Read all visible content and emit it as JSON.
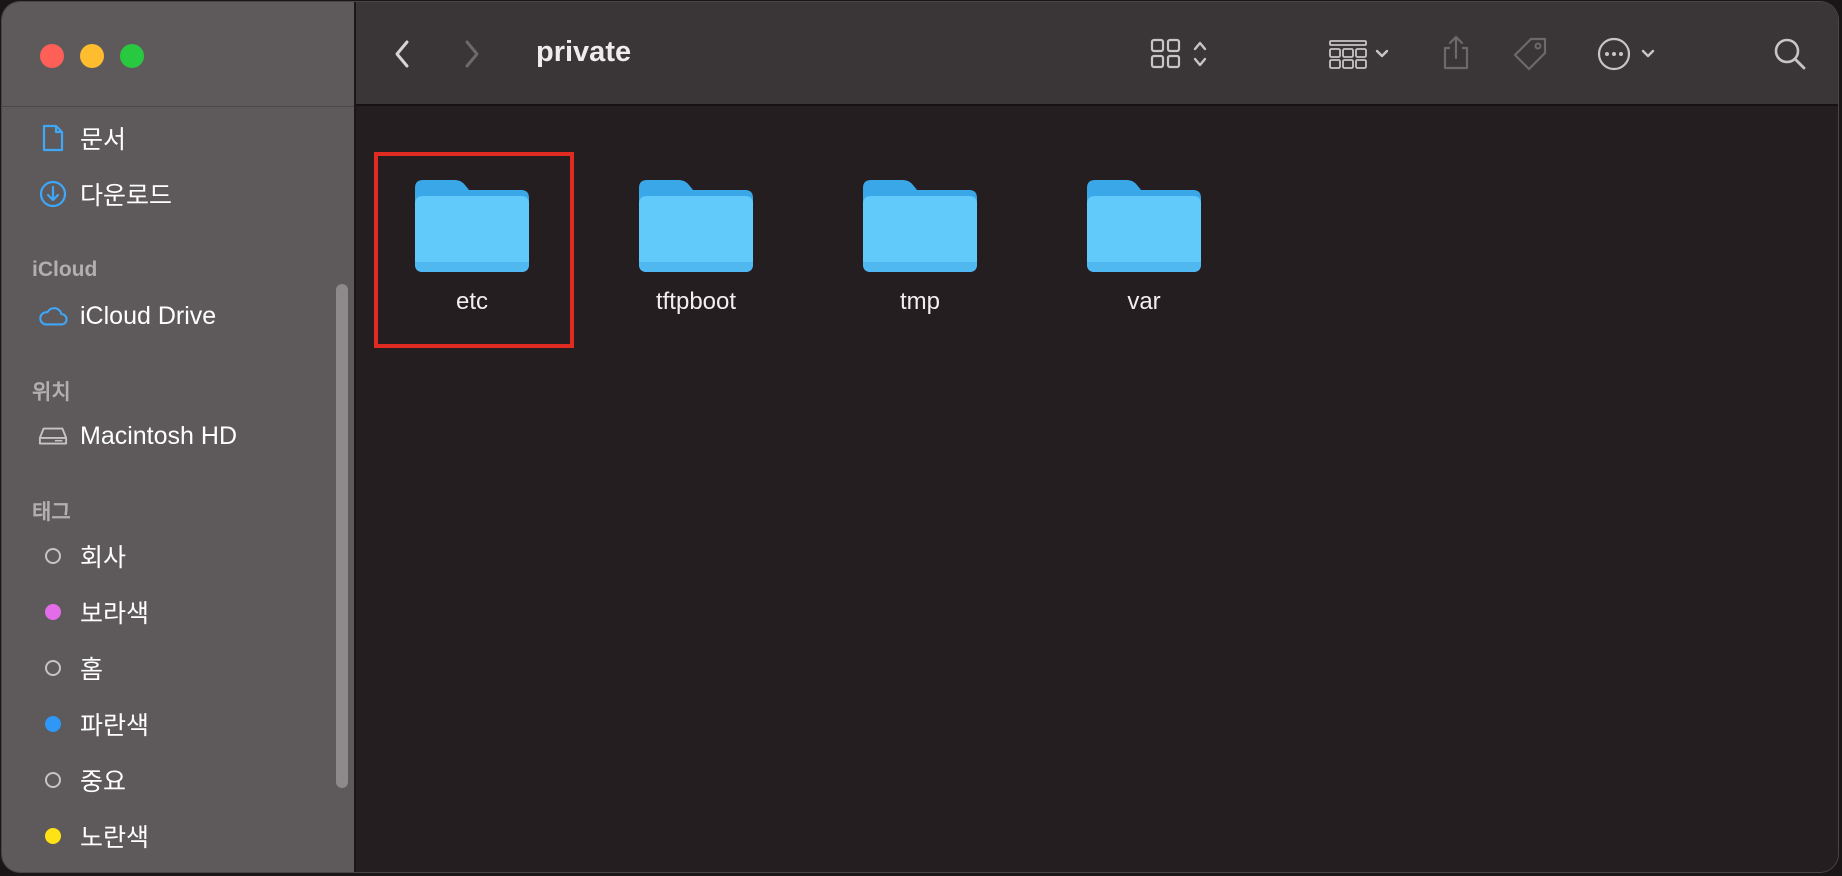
{
  "window": {
    "title": "private"
  },
  "sidebar": {
    "favorites": [
      {
        "label": "문서",
        "icon": "document-icon"
      },
      {
        "label": "다운로드",
        "icon": "download-icon"
      }
    ],
    "sections": {
      "icloud_heading": "iCloud",
      "icloud_items": [
        {
          "label": "iCloud Drive",
          "icon": "cloud-icon"
        }
      ],
      "locations_heading": "위치",
      "locations_items": [
        {
          "label": "Macintosh HD",
          "icon": "hard-drive-icon"
        }
      ],
      "tags_heading": "태그",
      "tags": [
        {
          "label": "회사",
          "color": ""
        },
        {
          "label": "보라색",
          "color": "#e36ce8"
        },
        {
          "label": "홈",
          "color": ""
        },
        {
          "label": "파란색",
          "color": "#2f97f5"
        },
        {
          "label": "중요",
          "color": ""
        },
        {
          "label": "노란색",
          "color": "#ffe216"
        }
      ]
    }
  },
  "toolbar": {
    "back_icon": "chevron-left-icon",
    "forward_icon": "chevron-right-icon",
    "view_icon": "grid-view-icon",
    "group_icon": "group-by-icon",
    "share_icon": "share-icon",
    "tag_icon": "tag-icon",
    "more_icon": "ellipsis-circle-icon",
    "search_icon": "search-icon"
  },
  "content": {
    "folders": [
      {
        "name": "etc",
        "selected_highlight": true
      },
      {
        "name": "tftpboot",
        "selected_highlight": false
      },
      {
        "name": "tmp",
        "selected_highlight": false
      },
      {
        "name": "var",
        "selected_highlight": false
      }
    ]
  },
  "colors": {
    "folder_blue": "#5ec8fa",
    "highlight_red": "#e02b22",
    "accent_blue": "#2f97f5"
  }
}
